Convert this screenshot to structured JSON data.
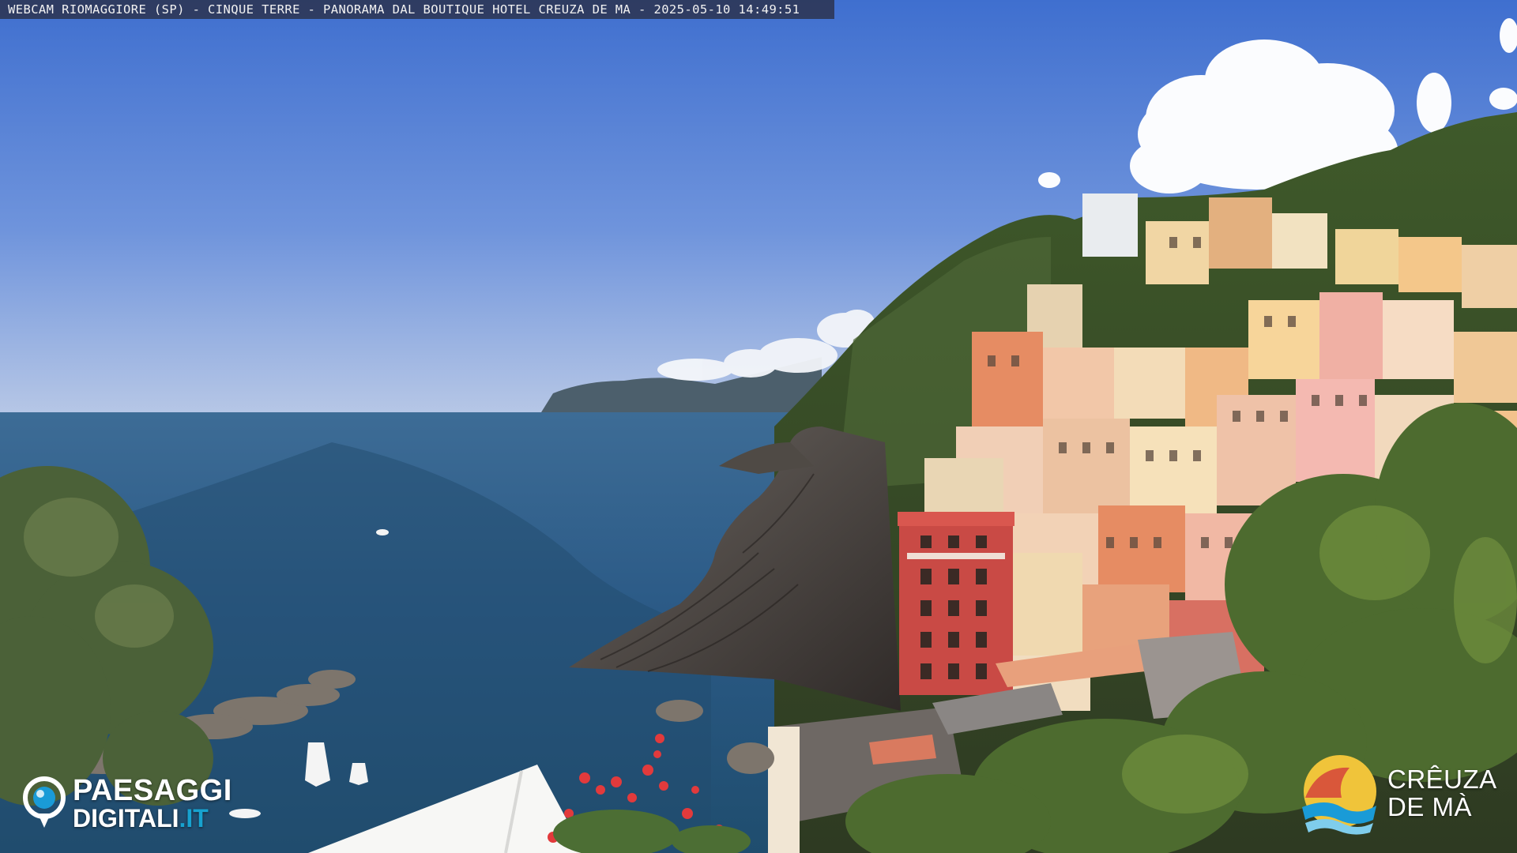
{
  "overlay": {
    "caption": "WEBCAM RIOMAGGIORE (SP) - CINQUE TERRE - PANORAMA DAL BOUTIQUE HOTEL CREUZA DE MA - 2025-05-10 14:49:51"
  },
  "logo_left": {
    "line1": "PAESAGGI",
    "line2": "DIGITALI",
    "line2_suffix": ".IT",
    "accent_color": "#17a2cf"
  },
  "logo_right": {
    "line1": "CRÊUZA",
    "line2": "DE MÀ",
    "colors": [
      "#f0c43a",
      "#d9573a",
      "#1a9bd7"
    ]
  },
  "scene": {
    "sky_color": "#4a78d0",
    "sea_color": "#2a5a86"
  }
}
